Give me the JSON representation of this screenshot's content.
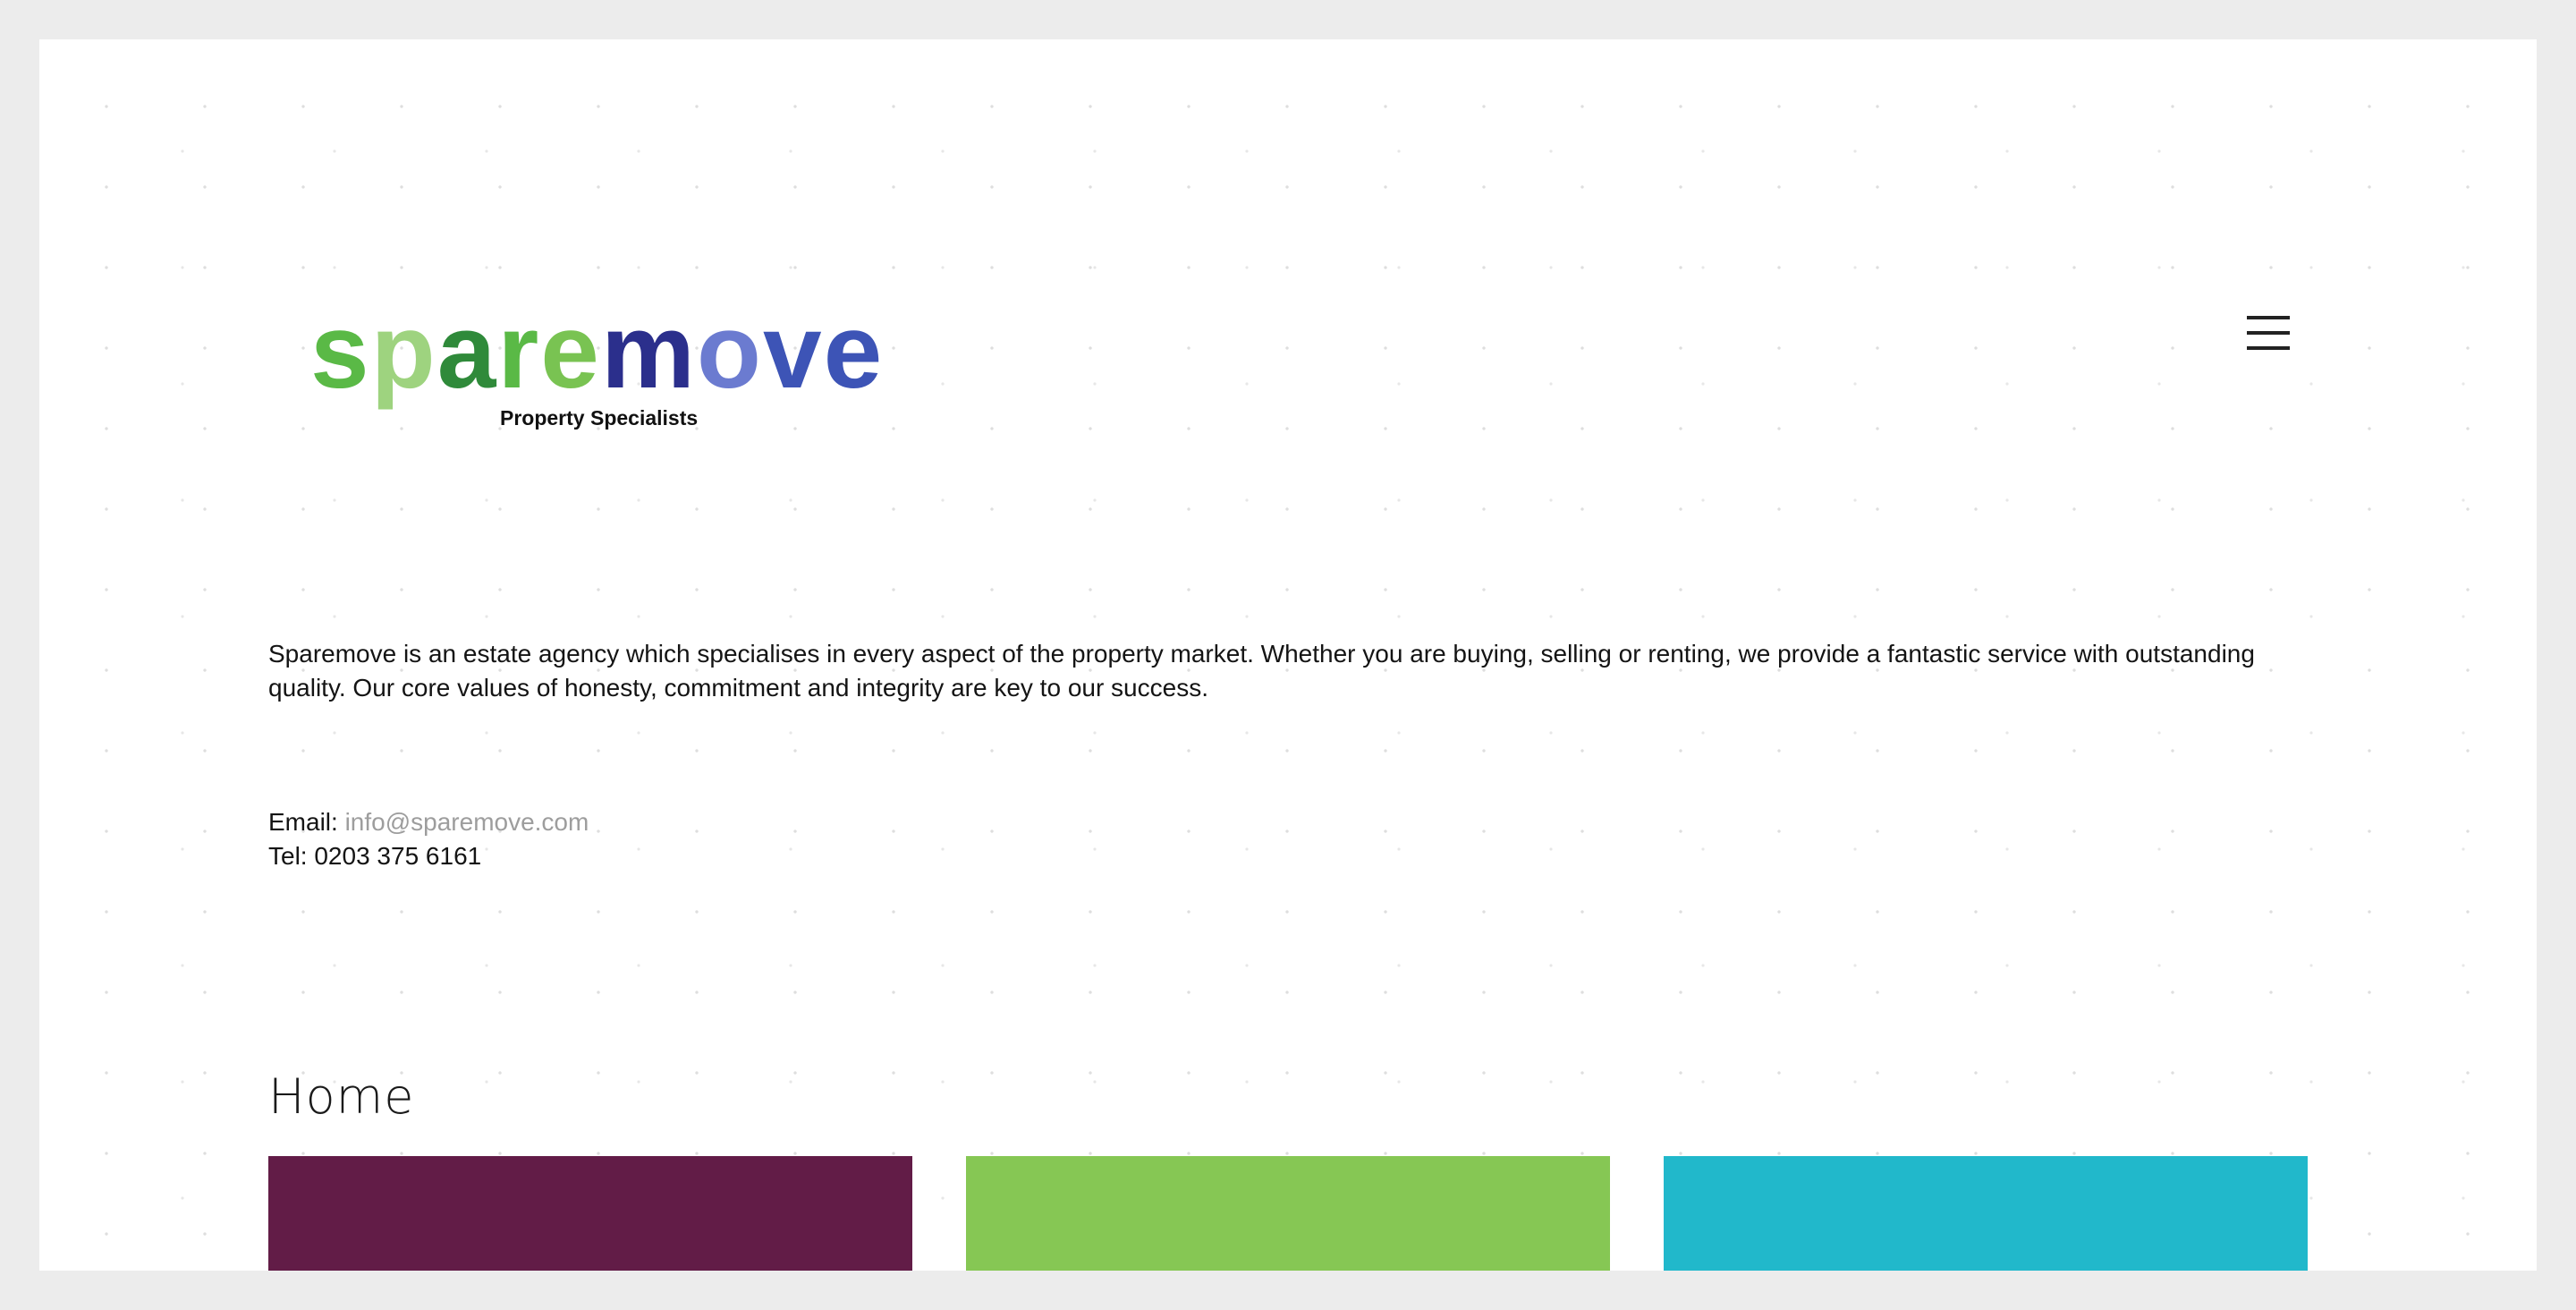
{
  "header": {
    "logo": {
      "wordmark": "sparemove",
      "tagline": "Property Specialists",
      "colors": {
        "green_light": "#9ed37f",
        "green": "#5ab946",
        "green_dark": "#2f8a3a",
        "blue_dark": "#2b2f8c",
        "blue": "#3d54b6",
        "blue_light": "#6b7bd0"
      }
    },
    "menu_icon": "hamburger-menu-icon"
  },
  "intro": {
    "text": "Sparemove is an estate agency which specialises in every aspect of the property market. Whether you are buying, selling or renting, we provide a fantastic service with outstanding quality. Our core values of honesty, commitment and integrity are key to our success."
  },
  "contact": {
    "email_label": "Email:",
    "email_value": "info@sparemove.com",
    "tel_label": "Tel:",
    "tel_value": "0203 375 6161"
  },
  "section": {
    "heading": "Home"
  },
  "tiles": [
    {
      "color": "#621c47"
    },
    {
      "color": "#86c754"
    },
    {
      "color": "#21b8cb"
    }
  ]
}
